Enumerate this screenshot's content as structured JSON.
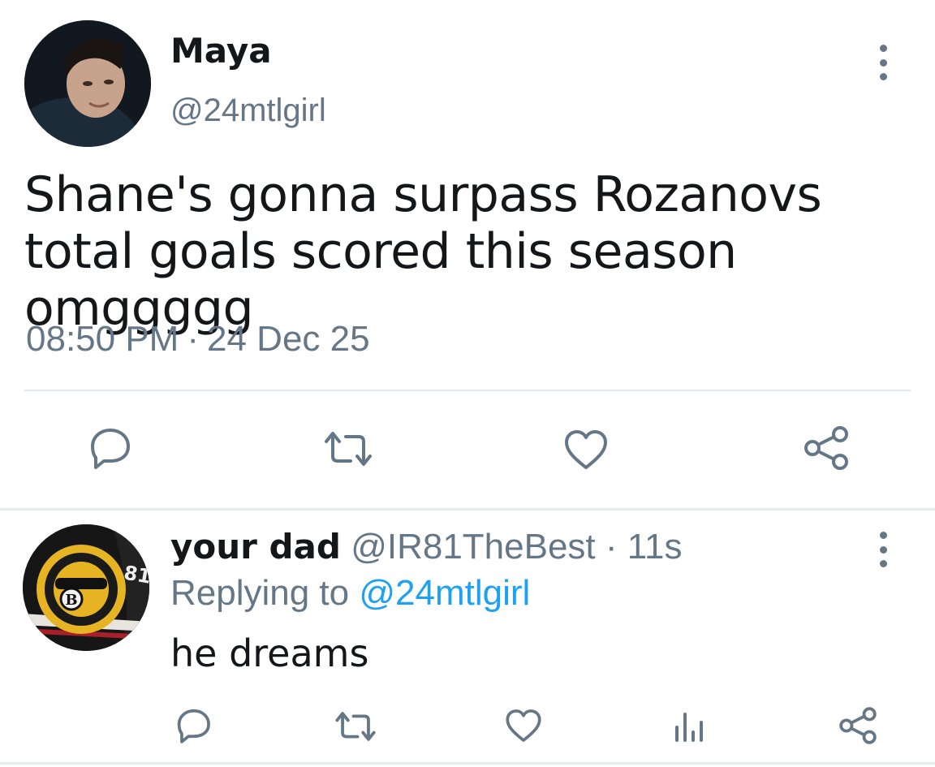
{
  "tweet": {
    "author_name": "Maya",
    "author_handle": "@24mtlgirl",
    "text": "Shane's gonna surpass Rozanovs total goals scored this season omggggg",
    "time": "08:50 PM",
    "separator": "·",
    "date": "24 Dec 25",
    "actions": [
      "reply-icon",
      "retweet-icon",
      "like-icon",
      "share-icon"
    ]
  },
  "reply": {
    "author_name": "your dad",
    "author_handle": "@IR81TheBest",
    "separator": "·",
    "time_ago": "11s",
    "replying_prefix": "Replying to",
    "replying_to": "@24mtlgirl",
    "text": "he dreams",
    "actions": [
      "reply-icon",
      "retweet-icon",
      "like-icon",
      "analytics-icon",
      "share-icon"
    ]
  },
  "colors": {
    "primary_text": "#14171a",
    "secondary_text": "#657786",
    "link": "#1da1f2",
    "divider": "#e1e8ed"
  }
}
